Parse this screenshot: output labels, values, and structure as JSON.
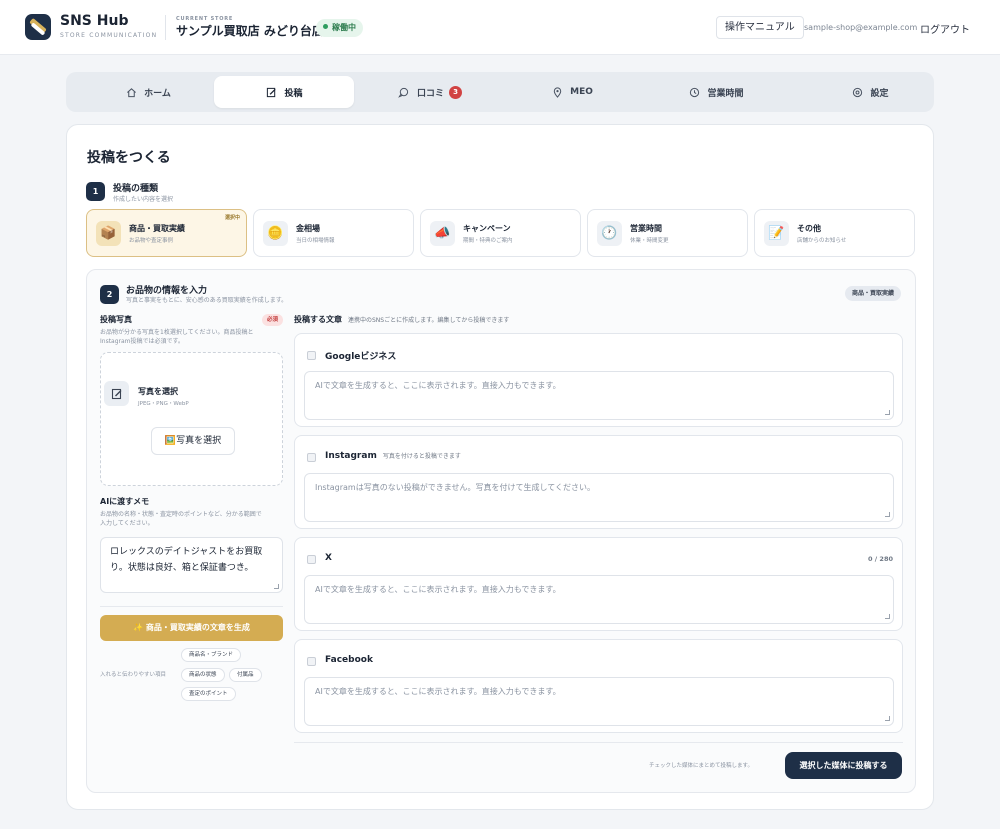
{
  "header": {
    "brand_name": "SNS Hub",
    "brand_sub": "STORE COMMUNICATION",
    "store_caption": "CURRENT STORE",
    "store_name": "サンプル買取店 みどり台店",
    "status": "稼働中",
    "manual_label": "操作マニュアル",
    "email": "sample-shop@example.com",
    "logout_label": "ログアウト"
  },
  "nav": {
    "tabs": [
      {
        "label": "ホーム",
        "icon": "home-icon"
      },
      {
        "label": "投稿",
        "icon": "edit-icon",
        "active": true
      },
      {
        "label": "口コミ",
        "icon": "chat-icon",
        "count": "3"
      },
      {
        "label": "MEO",
        "icon": "map-pin-icon"
      },
      {
        "label": "営業時間",
        "icon": "clock-icon"
      },
      {
        "label": "設定",
        "icon": "gear-icon"
      }
    ]
  },
  "page": {
    "title": "投稿をつくる",
    "step1": {
      "num": "1",
      "title": "投稿の種類",
      "sub": "作成したい内容を選択"
    },
    "types": [
      {
        "title": "商品・買取実績",
        "sub": "お品物や査定事例",
        "icon": "📦",
        "selected": true,
        "tag": "選択中"
      },
      {
        "title": "金相場",
        "sub": "当日の相場情報",
        "icon": "🪙"
      },
      {
        "title": "キャンペーン",
        "sub": "期間・特典のご案内",
        "icon": "📣"
      },
      {
        "title": "営業時間",
        "sub": "休業・時間変更",
        "icon": "🕐"
      },
      {
        "title": "その他",
        "sub": "店舗からのお知らせ",
        "icon": "📝"
      }
    ],
    "step2": {
      "num": "2",
      "title": "お品物の情報を入力",
      "sub": "写真と事実をもとに、安心感のある買取実績を作成します。",
      "badge": "商品・買取実績"
    },
    "photo": {
      "label": "投稿写真",
      "required": "必須",
      "hint_line1": "お品物が分かる写真を1枚選択してください。商品投稿と",
      "hint_line2": "Instagram投稿では必須です。",
      "drop_title": "写真を選択",
      "drop_sub": "JPEG・PNG・WebP",
      "button": "🖼️写真を選択"
    },
    "memo": {
      "label": "AIに渡すメモ",
      "hint_line1": "お品物の名称・状態・査定時のポイントなど、分かる範囲で",
      "hint_line2": "入力してください。",
      "value_line1": "ロレックスのデイトジャストをお買取",
      "value_line2": "り。状態は良好、箱と保証書つき。"
    },
    "generate_button": "✨ 商品・買取実績の文章を生成",
    "chips_label": "入れると伝わりやすい項目",
    "chips": [
      "商品名・ブランド",
      "商品の状態",
      "付属品",
      "査定のポイント"
    ],
    "post_text": {
      "label": "投稿する文章",
      "hint": "連携中のSNSごとに作成します。編集してから投稿できます"
    },
    "media": [
      {
        "name": "Googleビジネス",
        "note": "",
        "count": "",
        "placeholder": "AIで文章を生成すると、ここに表示されます。直接入力もできます。"
      },
      {
        "name": "Instagram",
        "note": "写真を付けると投稿できます",
        "count": "",
        "placeholder": "Instagramは写真のない投稿ができません。写真を付けて生成してください。"
      },
      {
        "name": "X",
        "note": "",
        "count": "0 / 280",
        "placeholder": "AIで文章を生成すると、ここに表示されます。直接入力もできます。"
      },
      {
        "name": "Facebook",
        "note": "",
        "count": "",
        "placeholder": "AIで文章を生成すると、ここに表示されます。直接入力もできます。"
      }
    ],
    "bottom_note": "チェックした媒体にまとめて投稿します。",
    "submit_button": "選択した媒体に投稿する"
  }
}
